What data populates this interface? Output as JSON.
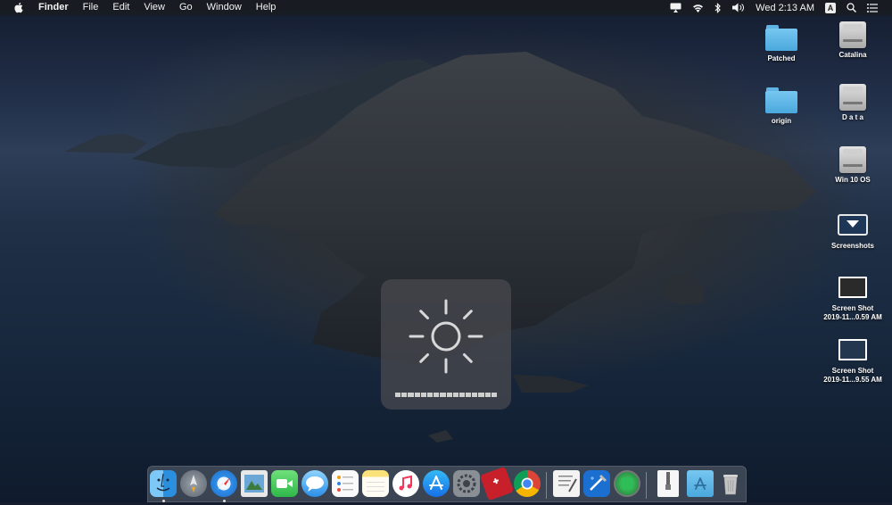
{
  "menubar": {
    "app_name": "Finder",
    "menus": [
      "File",
      "Edit",
      "View",
      "Go",
      "Window",
      "Help"
    ],
    "clock": "Wed 2:13 AM",
    "input_source": "A"
  },
  "desktop": {
    "icons": [
      {
        "label": "Patched",
        "icon": "folder-icon"
      },
      {
        "label": "Catalina",
        "icon": "hard-drive-icon"
      },
      {
        "label": "origin",
        "icon": "folder-icon"
      },
      {
        "label": "D a t a",
        "icon": "hard-drive-icon"
      },
      {
        "label": "Win 10 OS",
        "icon": "hard-drive-icon"
      },
      {
        "label": "Screenshots",
        "icon": "screenshots-folder-icon"
      },
      {
        "label": "Screen Shot",
        "sublabel": "2019-11...0.59 AM",
        "icon": "screenshot-thumbnail-icon"
      },
      {
        "label": "Screen Shot",
        "sublabel": "2019-11...9.55 AM",
        "icon": "screenshot-thumbnail-icon"
      }
    ]
  },
  "hud": {
    "type": "brightness",
    "icon": "sun-icon",
    "level": 1.0,
    "segments": 16
  },
  "dock": {
    "apps": [
      {
        "name": "Finder",
        "icon": "finder-icon",
        "running": true
      },
      {
        "name": "Launchpad",
        "icon": "launchpad-icon",
        "running": false
      },
      {
        "name": "Safari",
        "icon": "safari-icon",
        "running": true
      },
      {
        "name": "Preview",
        "icon": "preview-icon",
        "running": false
      },
      {
        "name": "FaceTime",
        "icon": "facetime-icon",
        "running": false
      },
      {
        "name": "Messages",
        "icon": "messages-icon",
        "running": false
      },
      {
        "name": "Reminders",
        "icon": "reminders-icon",
        "running": false
      },
      {
        "name": "Notes",
        "icon": "notes-icon",
        "running": false
      },
      {
        "name": "Music",
        "icon": "music-icon",
        "running": false
      },
      {
        "name": "App Store",
        "icon": "app-store-icon",
        "running": false
      },
      {
        "name": "System Preferences",
        "icon": "system-preferences-icon",
        "running": false
      },
      {
        "name": "Utility",
        "icon": "swiss-knife-icon",
        "running": false
      },
      {
        "name": "Chrome",
        "icon": "chrome-icon",
        "running": false
      },
      {
        "name": "Script Editor",
        "icon": "script-editor-icon",
        "running": false
      },
      {
        "name": "Xcode",
        "icon": "xcode-icon",
        "running": false
      },
      {
        "name": "Clover",
        "icon": "clover-icon",
        "running": false
      },
      {
        "name": "Archive",
        "icon": "zip-archive-icon",
        "running": false
      },
      {
        "name": "Applications",
        "icon": "applications-folder-icon",
        "running": false
      },
      {
        "name": "Trash",
        "icon": "trash-icon",
        "running": false
      }
    ]
  },
  "colors": {
    "menubar_bg": "#1c1f25",
    "folder_blue": "#5fb4e3",
    "hud_bg": "#46484e"
  }
}
